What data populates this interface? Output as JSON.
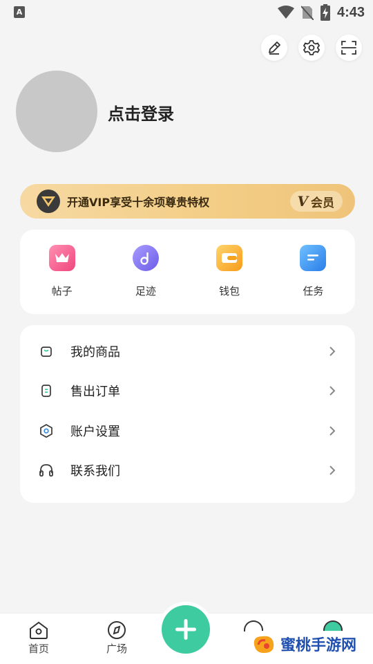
{
  "status_bar": {
    "time": "4:43",
    "left_badge": "A"
  },
  "top_actions": {
    "icons": [
      "edit-icon",
      "settings-icon",
      "scan-icon"
    ]
  },
  "profile": {
    "login_text": "点击登录"
  },
  "vip": {
    "text": "开通VIP享受十余项尊贵特权",
    "badge_v": "V",
    "badge_label": "会员"
  },
  "quick_grid": {
    "items": [
      {
        "label": "帖子",
        "icon": "crown-icon",
        "color": "#f25a8a"
      },
      {
        "label": "足迹",
        "icon": "music-note-icon",
        "color": "#7b6cf0"
      },
      {
        "label": "钱包",
        "icon": "wallet-icon",
        "color": "#f7a21d"
      },
      {
        "label": "任务",
        "icon": "task-icon",
        "color": "#2f8cf0"
      }
    ]
  },
  "menu": {
    "items": [
      {
        "label": "我的商品",
        "icon": "bag-icon"
      },
      {
        "label": "售出订单",
        "icon": "order-icon"
      },
      {
        "label": "账户设置",
        "icon": "hexagon-settings-icon"
      },
      {
        "label": "联系我们",
        "icon": "headset-icon"
      }
    ]
  },
  "tabbar": {
    "items": [
      {
        "label": "首页",
        "icon": "home-icon"
      },
      {
        "label": "广场",
        "icon": "compass-icon"
      }
    ],
    "fab_icon": "plus-icon",
    "accent": "#3ecba0"
  },
  "watermark": {
    "text": "蜜桃手游网"
  }
}
